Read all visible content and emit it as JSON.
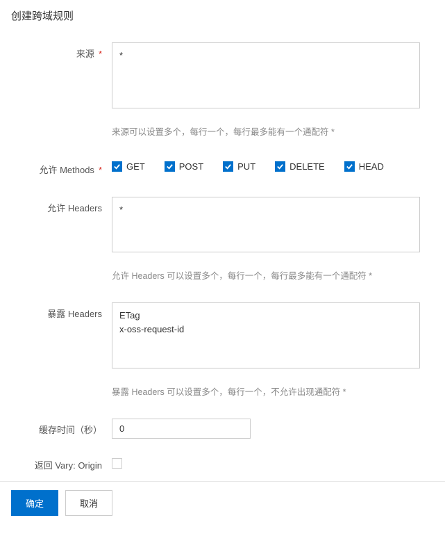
{
  "title": "创建跨域规则",
  "origin": {
    "label": "来源",
    "value": "*",
    "hint": "来源可以设置多个，每行一个，每行最多能有一个通配符 *"
  },
  "methods": {
    "label": "允许 Methods",
    "options": [
      {
        "name": "GET",
        "checked": true
      },
      {
        "name": "POST",
        "checked": true
      },
      {
        "name": "PUT",
        "checked": true
      },
      {
        "name": "DELETE",
        "checked": true
      },
      {
        "name": "HEAD",
        "checked": true
      }
    ]
  },
  "allowHeaders": {
    "label": "允许 Headers",
    "value": "*",
    "hint": "允许 Headers 可以设置多个，每行一个，每行最多能有一个通配符 *"
  },
  "exposeHeaders": {
    "label": "暴露 Headers",
    "value": "ETag\nx-oss-request-id",
    "hint": "暴露 Headers 可以设置多个，每行一个，不允许出现通配符 *"
  },
  "cacheTime": {
    "label": "缓存时间（秒）",
    "value": "0"
  },
  "varyOrigin": {
    "label": "返回 Vary: Origin",
    "checked": false
  },
  "buttons": {
    "ok": "确定",
    "cancel": "取消"
  },
  "requiredMark": "*"
}
